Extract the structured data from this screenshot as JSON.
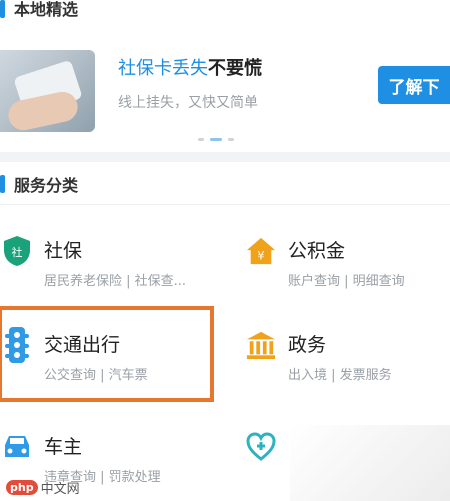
{
  "local_picks": {
    "title": "本地精选"
  },
  "banner": {
    "headline_accent": "社保卡丢失",
    "headline_rest": "不要慌",
    "subtitle": "线上挂失，又快又简单",
    "button_label": "了解下"
  },
  "services": {
    "title": "服务分类",
    "items": [
      {
        "name": "社保",
        "desc": "居民养老保险 | 社保查...",
        "icon": "shield-icon",
        "color": "#1aa27a"
      },
      {
        "name": "公积金",
        "desc": "账户查询 | 明细查询",
        "icon": "house-icon",
        "color": "#f0a21b"
      },
      {
        "name": "交通出行",
        "desc": "公交查询 | 汽车票",
        "icon": "traffic-light-icon",
        "color": "#2f9ae6"
      },
      {
        "name": "政务",
        "desc": "出入境 | 发票服务",
        "icon": "government-building-icon",
        "color": "#f0a21b"
      },
      {
        "name": "车主",
        "desc": "违章查询 | 罚款处理",
        "icon": "car-icon",
        "color": "#2f9ae6"
      },
      {
        "name": "",
        "desc": "",
        "icon": "heart-shield-icon",
        "color": "#2bb3c0"
      }
    ]
  },
  "watermark": {
    "logo": "php",
    "text": "中文网"
  },
  "colors": {
    "accent": "#1f8fe3",
    "highlight": "#e6772e"
  }
}
